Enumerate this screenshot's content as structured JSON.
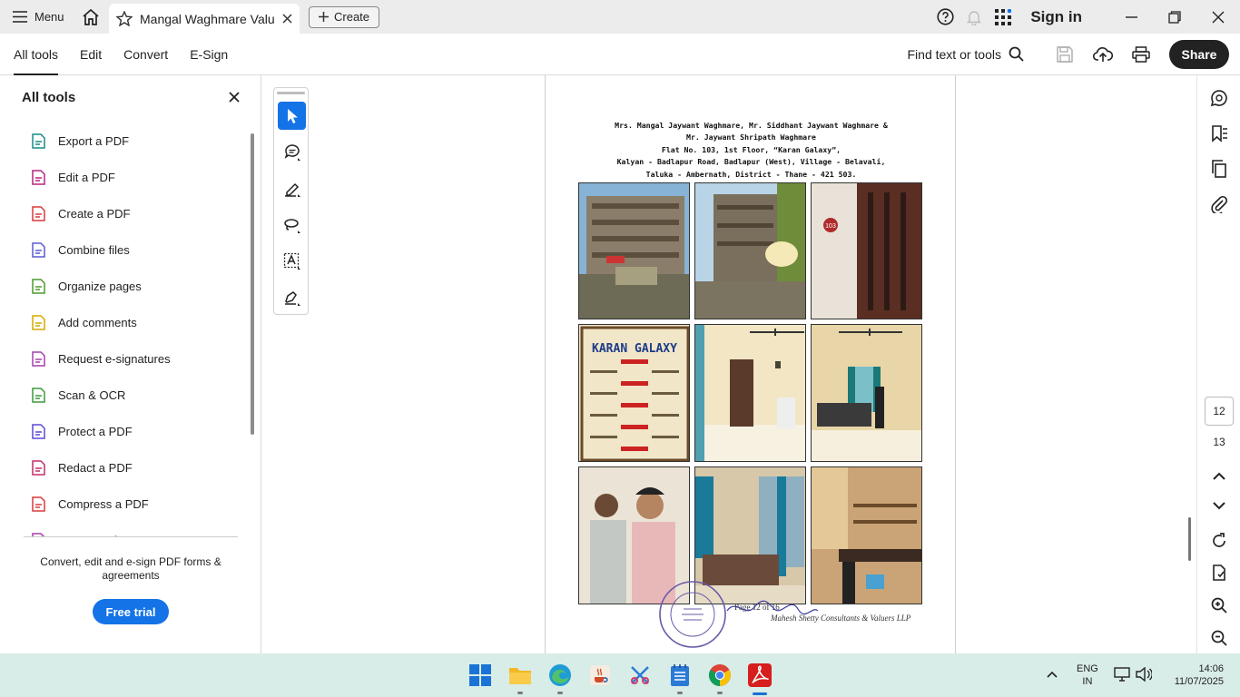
{
  "titlebar": {
    "menu_label": "Menu",
    "tab_title": "Mangal Waghmare Valu...",
    "create_label": "Create",
    "signin_label": "Sign in"
  },
  "toolbar": {
    "tabs": [
      "All tools",
      "Edit",
      "Convert",
      "E-Sign"
    ],
    "find_label": "Find text or tools",
    "share_label": "Share"
  },
  "left_panel": {
    "title": "All tools",
    "items": [
      {
        "label": "Export a PDF",
        "icon": "export-pdf-icon",
        "color": "#1a8a8a"
      },
      {
        "label": "Edit a PDF",
        "icon": "edit-pdf-icon",
        "color": "#b7247d"
      },
      {
        "label": "Create a PDF",
        "icon": "create-pdf-icon",
        "color": "#d83b3b"
      },
      {
        "label": "Combine files",
        "icon": "combine-files-icon",
        "color": "#5a5ad6"
      },
      {
        "label": "Organize pages",
        "icon": "organize-pages-icon",
        "color": "#4a9a2a"
      },
      {
        "label": "Add comments",
        "icon": "add-comments-icon",
        "color": "#d6a800"
      },
      {
        "label": "Request e-signatures",
        "icon": "request-esign-icon",
        "color": "#a53fb0"
      },
      {
        "label": "Scan & OCR",
        "icon": "scan-ocr-icon",
        "color": "#3a9a3a"
      },
      {
        "label": "Protect a PDF",
        "icon": "protect-pdf-icon",
        "color": "#5a4ad6"
      },
      {
        "label": "Redact a PDF",
        "icon": "redact-pdf-icon",
        "color": "#c42d6a"
      },
      {
        "label": "Compress a PDF",
        "icon": "compress-pdf-icon",
        "color": "#d83b3b"
      },
      {
        "label": "Prepare a form",
        "icon": "prepare-form-icon",
        "color": "#a53fb0"
      }
    ],
    "promo_text": "Convert, edit and e-sign PDF forms & agreements",
    "trial_label": "Free trial"
  },
  "document": {
    "address_lines": [
      "Mrs. Mangal Jaywant Waghmare, Mr. Siddhant Jaywant Waghmare &",
      "Mr. Jaywant Shripath Waghmare",
      "Flat No. 103, 1st Floor, “Karan Galaxy”,",
      "Kalyan - Badlapur Road, Badlapur (West), Village - Belavali,",
      "Taluka - Ambernath, District - Thane - 421 503."
    ],
    "sign_text": "KARAN GALAXY",
    "door_number": "103",
    "page_label": "Page 12 of 16",
    "firm_label": "Mahesh Shetty Consultants & Valuers LLP"
  },
  "right_rail": {
    "current_page": "12",
    "next_page": "13"
  },
  "taskbar": {
    "lang_top": "ENG",
    "lang_bottom": "IN",
    "time": "14:06",
    "date": "11/07/2025"
  }
}
